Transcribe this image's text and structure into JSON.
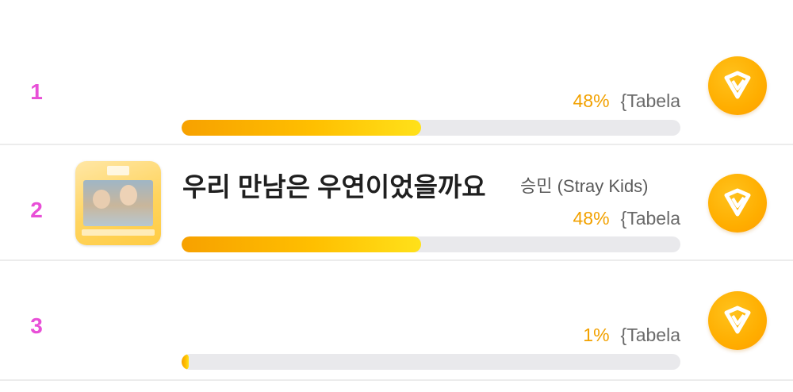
{
  "rankings": [
    {
      "rank": "1",
      "title": "",
      "artist": "",
      "percent": "48%",
      "percent_value": 48,
      "suffix": "{Tabela"
    },
    {
      "rank": "2",
      "title": "우리 만남은 우연이었을까요",
      "artist": "승민 (Stray Kids)",
      "percent": "48%",
      "percent_value": 48,
      "suffix": "{Tabela"
    },
    {
      "rank": "3",
      "title": "",
      "artist": "",
      "percent": "1%",
      "percent_value": 1,
      "suffix": "{Tabela"
    }
  ],
  "colors": {
    "rank": "#e84fd7",
    "percent": "#f2a100",
    "bar_fill": "#ffbf00",
    "track": "#e9e9ec",
    "vote_button": "#ffae00"
  },
  "icons": {
    "vote": "heart-diamond-icon"
  }
}
